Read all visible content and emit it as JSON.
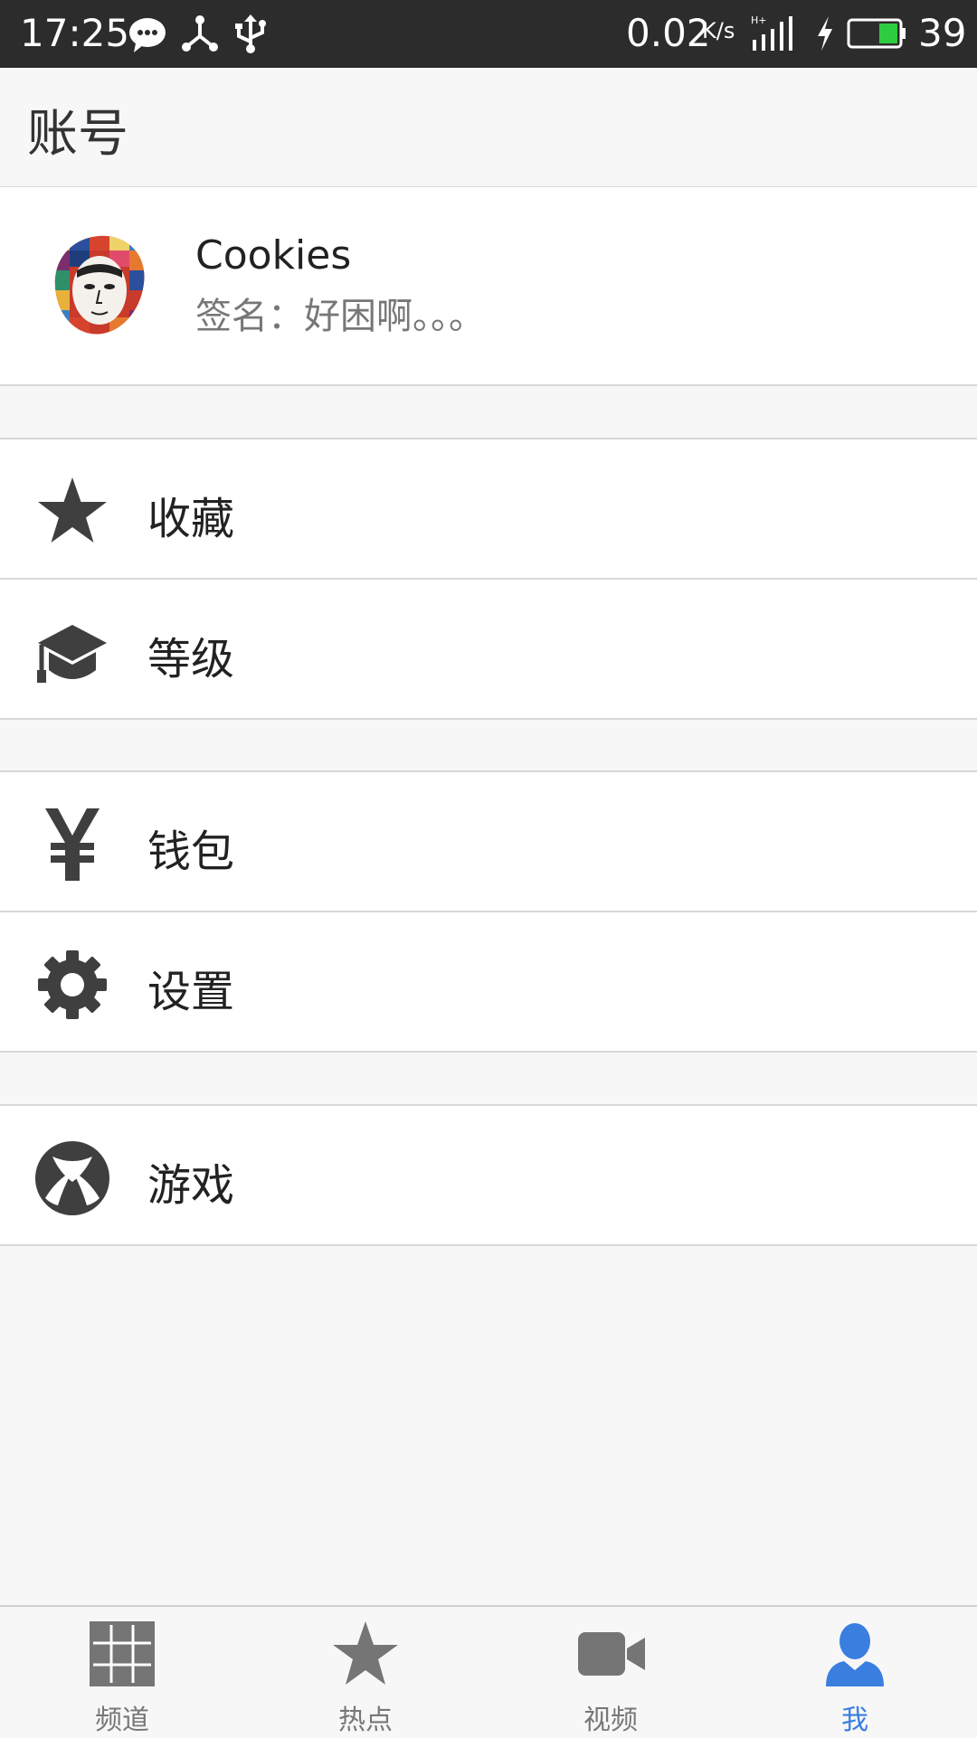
{
  "status_bar": {
    "time": "17:25",
    "network_speed": "0.02",
    "speed_unit": "K/s",
    "battery_level": "39",
    "icons": [
      "wechat-icon",
      "network-share-icon",
      "usb-icon",
      "hplus-signal-icon",
      "charging-icon",
      "battery-icon"
    ]
  },
  "header": {
    "title": "账号"
  },
  "profile": {
    "name": "Cookies",
    "signature": "签名：好困啊。。。"
  },
  "menu": {
    "favorites": "收藏",
    "level": "等级",
    "wallet": "钱包",
    "settings": "设置",
    "games": "游戏"
  },
  "bottom_nav": {
    "tabs": [
      {
        "label": "频道",
        "icon": "grid-icon"
      },
      {
        "label": "热点",
        "icon": "star-icon"
      },
      {
        "label": "视频",
        "icon": "video-camera-icon"
      },
      {
        "label": "我",
        "icon": "person-icon"
      }
    ],
    "active": "我"
  },
  "colors": {
    "status_bar_bg": "#2c2c2c",
    "active_tab": "#3a7ee0",
    "icon_dark": "#3f3f3f",
    "battery_fill": "#2ecc40"
  }
}
